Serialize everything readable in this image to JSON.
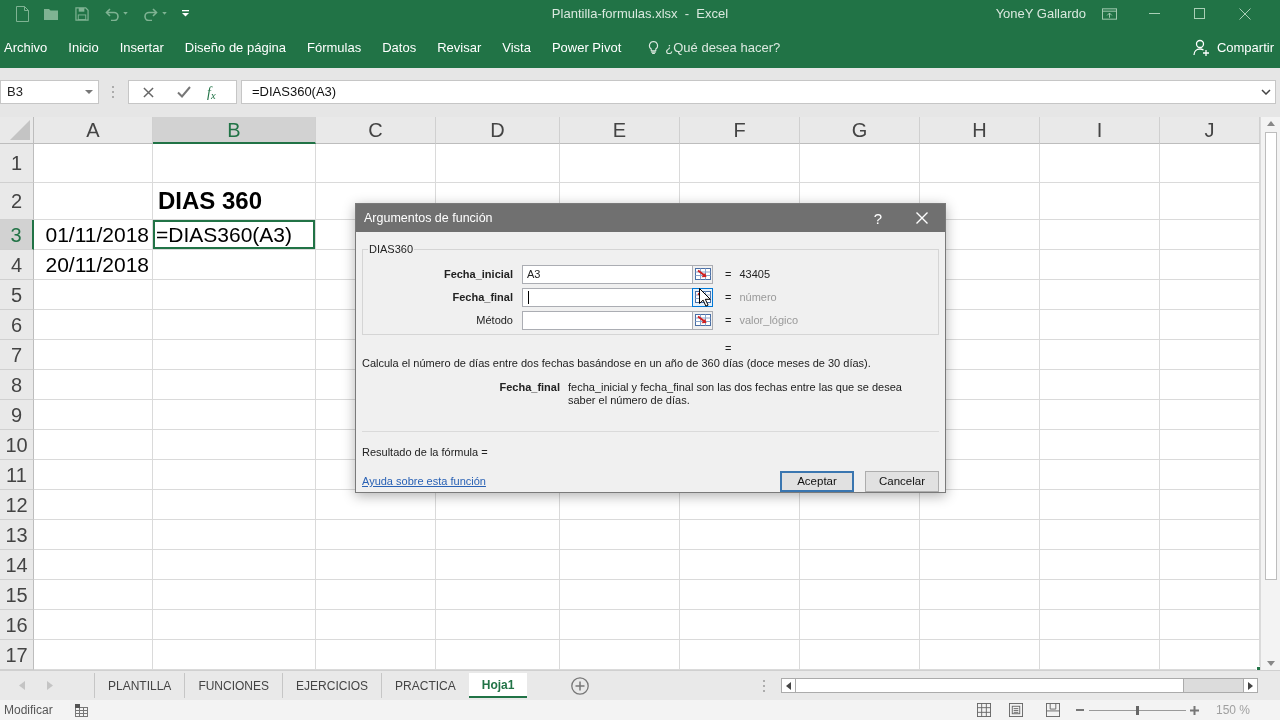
{
  "title_bar": {
    "title": "Plantilla-formulas.xlsx  -  Excel",
    "user": "YoneY Gallardo"
  },
  "ribbon": {
    "tabs": [
      {
        "label": "Archivo",
        "selected": false
      },
      {
        "label": "Inicio",
        "selected": false
      },
      {
        "label": "Insertar",
        "selected": false
      },
      {
        "label": "Diseño de página",
        "selected": false
      },
      {
        "label": "Fórmulas",
        "selected": false
      },
      {
        "label": "Datos",
        "selected": false
      },
      {
        "label": "Revisar",
        "selected": false
      },
      {
        "label": "Vista",
        "selected": false
      },
      {
        "label": "Power Pivot",
        "selected": false
      }
    ],
    "tell_me": {
      "placeholder": "¿Qué desea hacer?"
    },
    "share": "Compartir"
  },
  "formula_bar": {
    "name_box": "B3",
    "function_button": "f$_{x}$",
    "formula": "=DIAS360(A3)"
  },
  "sheet": {
    "columns": [
      {
        "label": "A",
        "selected": false
      },
      {
        "label": "B",
        "selected": true
      },
      {
        "label": "C",
        "selected": false
      },
      {
        "label": "D",
        "selected": false
      },
      {
        "label": "E",
        "selected": false
      },
      {
        "label": "F",
        "selected": false
      },
      {
        "label": "G",
        "selected": false
      },
      {
        "label": "H",
        "selected": false
      },
      {
        "label": "I",
        "selected": false
      },
      {
        "label": "J",
        "selected": false
      }
    ],
    "rows": [
      {
        "header": "1",
        "selected": false
      },
      {
        "header": "2",
        "selected": false,
        "column_b": {
          "kind": "heading",
          "text": "DIAS 360",
          "selected": false
        }
      },
      {
        "header": "3",
        "selected": true,
        "column_a": {
          "kind": "date",
          "text": "01/11/2018",
          "selected": false
        },
        "column_b": {
          "kind": "editing",
          "text": "=DIAS360(A3)",
          "selected": true
        }
      },
      {
        "header": "4",
        "selected": false,
        "column_a": {
          "kind": "date",
          "text": "20/11/2018",
          "selected": false
        }
      },
      {
        "header": "5",
        "selected": false
      },
      {
        "header": "6",
        "selected": false
      },
      {
        "header": "7",
        "selected": false
      },
      {
        "header": "8",
        "selected": false
      },
      {
        "header": "9",
        "selected": false
      },
      {
        "header": "10",
        "selected": false
      },
      {
        "header": "11",
        "selected": false
      },
      {
        "header": "12",
        "selected": false
      },
      {
        "header": "13",
        "selected": false
      },
      {
        "header": "14",
        "selected": false
      },
      {
        "header": "15",
        "selected": false
      },
      {
        "header": "16",
        "selected": false
      },
      {
        "header": "17",
        "selected": false
      }
    ]
  },
  "dialog": {
    "title": "Argumentos de función",
    "help_button": "?",
    "function_name": "DIAS360",
    "arguments": [
      {
        "label": "Fecha_inicial",
        "required": true,
        "value": "A3",
        "focused": false,
        "picker_hovered": false,
        "equals": "=",
        "result": {
          "kind": "value",
          "text": "43405"
        }
      },
      {
        "label": "Fecha_final",
        "required": true,
        "focused": true,
        "picker_hovered": true,
        "equals": "=",
        "result": {
          "kind": "hint",
          "text": "número"
        }
      },
      {
        "label": "Método",
        "required": false,
        "focused": false,
        "picker_hovered": false,
        "equals": "=",
        "result": {
          "kind": "hint",
          "text": "valor_lógico"
        }
      }
    ],
    "function_result": "=",
    "description": "Calcula el número de días entre dos fechas basándose en un año de 360 días (doce meses de 30 días).",
    "argument_help": {
      "label": "Fecha_final",
      "text": "fecha_inicial y fecha_final son las dos fechas entre las que se desea saber el número de días."
    },
    "formula_result": "Resultado de la fórmula =",
    "help_link": "Ayuda sobre esta función",
    "buttons": [
      {
        "label": "Aceptar",
        "default": true
      },
      {
        "label": "Cancelar",
        "default": false
      }
    ]
  },
  "sheet_tabs": [
    {
      "label": "PLANTILLA",
      "selected": false
    },
    {
      "label": "FUNCIONES",
      "selected": false
    },
    {
      "label": "EJERCICIOS",
      "selected": false
    },
    {
      "label": "PRACTICA",
      "selected": false
    },
    {
      "label": "Hoja1",
      "selected": true
    }
  ],
  "status_bar": {
    "mode": "Modificar",
    "zoom_slider": {
      "level": 0.5
    },
    "zoom": "150 %"
  }
}
